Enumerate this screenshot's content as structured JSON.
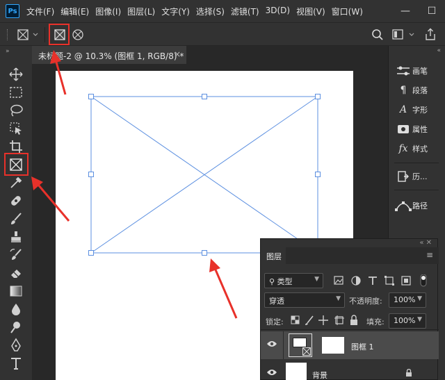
{
  "app": {
    "logo": "Ps"
  },
  "menu": [
    "文件(F)",
    "编辑(E)",
    "图像(I)",
    "图层(L)",
    "文字(Y)",
    "选择(S)",
    "滤镜(T)",
    "3D(D)",
    "视图(V)",
    "窗口(W)"
  ],
  "window_controls": {
    "minimize": "—",
    "maximize": "☐"
  },
  "document": {
    "tab_title": "未标题-2 @ 10.3% (图框 1, RGB/8) *",
    "close": "×"
  },
  "panels": [
    {
      "icon": "brush-settings-icon",
      "label": "画笔"
    },
    {
      "icon": "paragraph-icon",
      "glyph": "¶",
      "label": "段落"
    },
    {
      "icon": "character-icon",
      "glyph": "A",
      "label": "字形"
    },
    {
      "icon": "properties-icon",
      "label": "属性"
    },
    {
      "icon": "styles-icon",
      "glyph": "fx",
      "label": "样式"
    },
    {
      "icon": "history-icon",
      "label": "历..."
    },
    {
      "icon": "paths-icon",
      "label": "路径"
    }
  ],
  "layers_panel": {
    "tab": "图层",
    "filter_kind": "类型",
    "blend_mode": "穿透",
    "opacity_label": "不透明度:",
    "opacity_value": "100%",
    "lock_label": "锁定:",
    "fill_label": "填充:",
    "fill_value": "100%",
    "layers": [
      {
        "name": "图框 1",
        "selected": true
      },
      {
        "name": "背景",
        "selected": false
      }
    ]
  },
  "colors": {
    "accent": "#e8312a",
    "frame": "#5b8fe0",
    "bg": "#282828",
    "panel": "#323232"
  }
}
